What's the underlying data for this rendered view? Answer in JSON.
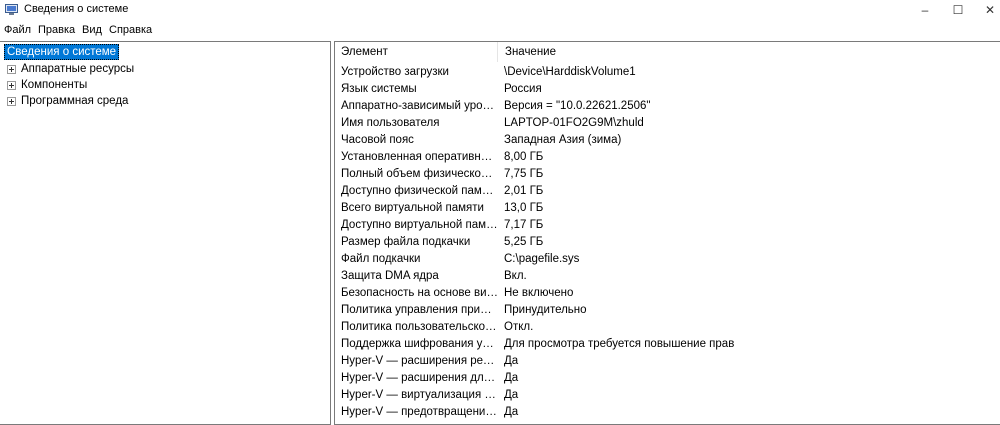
{
  "window": {
    "title": "Сведения о системе",
    "icon": "system-info-icon",
    "controls": {
      "minimize": "–",
      "maximize": "☐",
      "close": "✕"
    }
  },
  "menu": [
    "Файл",
    "Правка",
    "Вид",
    "Справка"
  ],
  "tree": {
    "root": "Сведения о системе",
    "items": [
      "Аппаратные ресурсы",
      "Компоненты",
      "Программная среда"
    ]
  },
  "table": {
    "headers": {
      "element": "Элемент",
      "value": "Значение"
    },
    "rows": [
      {
        "element": "Устройство загрузки",
        "value": "\\Device\\HarddiskVolume1"
      },
      {
        "element": "Язык системы",
        "value": "Россия"
      },
      {
        "element": "Аппаратно-зависимый уровен...",
        "value": "Версия = \"10.0.22621.2506\""
      },
      {
        "element": "Имя пользователя",
        "value": "LAPTOP-01FO2G9M\\zhuld"
      },
      {
        "element": "Часовой пояс",
        "value": "Западная Азия (зима)"
      },
      {
        "element": "Установленная оперативная п...",
        "value": "8,00 ГБ"
      },
      {
        "element": "Полный объем физической па...",
        "value": "7,75 ГБ"
      },
      {
        "element": "Доступно физической памяти",
        "value": "2,01 ГБ"
      },
      {
        "element": "Всего виртуальной памяти",
        "value": "13,0 ГБ"
      },
      {
        "element": "Доступно виртуальной памяти",
        "value": "7,17 ГБ"
      },
      {
        "element": "Размер файла подкачки",
        "value": "5,25 ГБ"
      },
      {
        "element": "Файл подкачки",
        "value": "C:\\pagefile.sys"
      },
      {
        "element": "Защита DMA ядра",
        "value": "Вкл."
      },
      {
        "element": "Безопасность на основе вирту...",
        "value": "Не включено"
      },
      {
        "element": "Политика управления прилож...",
        "value": "Принудительно"
      },
      {
        "element": "Политика пользовательского ...",
        "value": "Откл."
      },
      {
        "element": "Поддержка шифрования устр...",
        "value": "Для просмотра требуется повышение прав"
      },
      {
        "element": "Hyper-V — расширения реж...",
        "value": "Да"
      },
      {
        "element": "Hyper-V — расширения для п...",
        "value": "Да"
      },
      {
        "element": "Hyper-V — виртуализация вкл...",
        "value": "Да"
      },
      {
        "element": "Hyper-V — предотвращение в...",
        "value": "Да"
      }
    ]
  }
}
